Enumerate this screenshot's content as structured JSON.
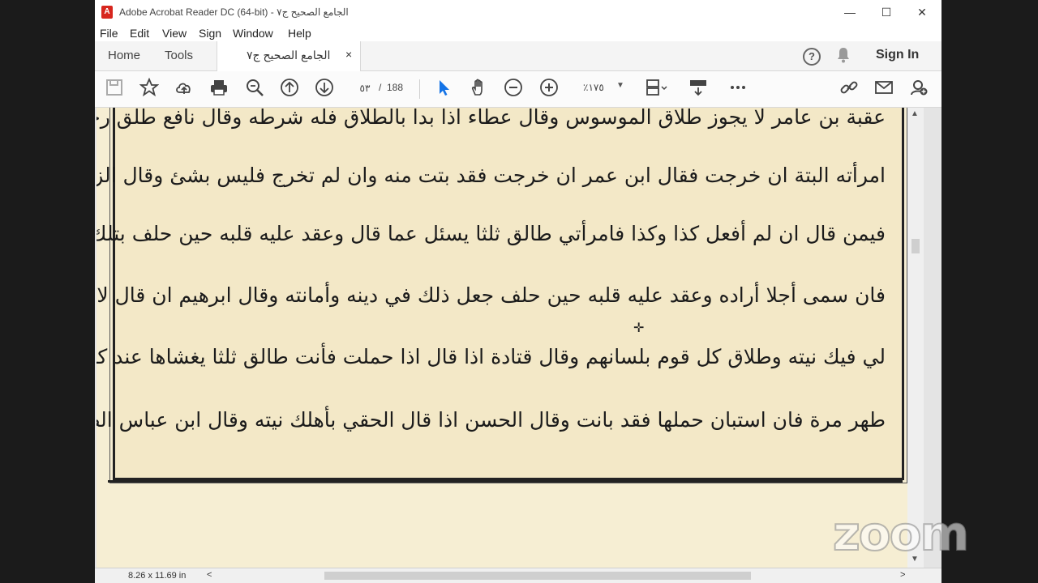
{
  "window": {
    "title": "الجامع الصحيح ج٧ - Adobe Acrobat Reader DC (64-bit)",
    "minimize": "—",
    "maximize": "☐",
    "close": "✕"
  },
  "menu": [
    "File",
    "Edit",
    "View",
    "Sign",
    "Window",
    "Help"
  ],
  "tabs": {
    "home": "Home",
    "tools": "Tools",
    "document": "الجامع الصحيح ج٧",
    "close": "×"
  },
  "header": {
    "help": "?",
    "sign_in": "Sign In"
  },
  "toolbar": {
    "page_current": "٥٣",
    "page_separator": "/",
    "page_total": "188",
    "zoom": "١٧٥٪"
  },
  "document": {
    "lines": [
      "عقبة بن عامر لا يجوز طلاق الموسوس وقال عطاء اذا بدا بالطلاق فله شرطه وقال نافع طلق رجل",
      "امرأته البتة ان خرجت فقال ابن عمر ان خرجت فقد بتت منه وان لم تخرج فليس بشئ وقال الزهري",
      "فيمن قال ان لم أفعل كذا وكذا فامرأتي طالق ثلثا يسئل عما قال وعقد عليه قلبه حين حلف بتلك اليمين",
      "فان سمى أجلا أراده وعقد عليه قلبه حين حلف جعل ذلك في دينه وأمانته وقال ابرهيم ان قال لا حاجة",
      "لي فيك نيته وطلاق كل قوم بلسانهم وقال قتادة اذا قال اذا حملت فأنت طالق ثلثا يغشاها عند كل",
      "طهر مرة فان استبان حملها فقد بانت وقال الحسن اذا قال الحقي بأهلك نيته وقال ابن عباس الطلاق"
    ]
  },
  "status": {
    "page_size": "8.26 x 11.69 in",
    "scroll_left": "<",
    "scroll_right": ">"
  },
  "overlay": {
    "watermark": "zoom"
  }
}
